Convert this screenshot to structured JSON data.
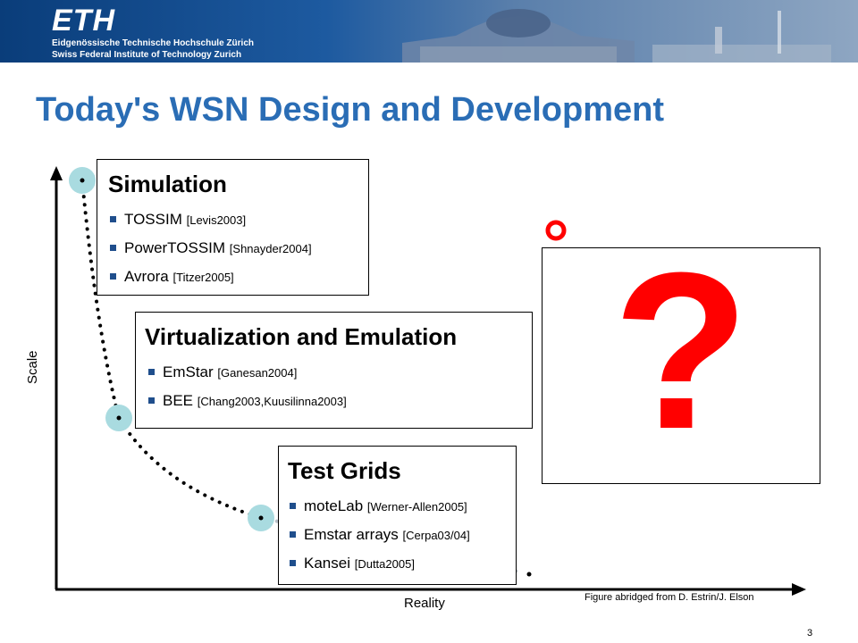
{
  "header": {
    "logo": "ETH",
    "institution_line1": "Eidgenössische Technische Hochschule Zürich",
    "institution_line2": "Swiss Federal Institute of Technology Zurich"
  },
  "title": "Today's WSN Design and Development",
  "boxes": {
    "simulation": {
      "heading": "Simulation",
      "items": [
        {
          "name": "TOSSIM",
          "ref": "[Levis2003]"
        },
        {
          "name": "PowerTOSSIM",
          "ref": "[Shnayder2004]"
        },
        {
          "name": "Avrora",
          "ref": "[Titzer2005]"
        }
      ]
    },
    "virtualization": {
      "heading": "Virtualization and Emulation",
      "items": [
        {
          "name": "EmStar",
          "ref": "[Ganesan2004]"
        },
        {
          "name": "BEE",
          "ref": "[Chang2003,Kuusilinna2003]"
        }
      ]
    },
    "testgrids": {
      "heading": "Test Grids",
      "items": [
        {
          "name": "moteLab",
          "ref": "[Werner-Allen2005]"
        },
        {
          "name": "Emstar arrays",
          "ref": "[Cerpa03/04]"
        },
        {
          "name": "Kansei",
          "ref": "[Dutta2005]"
        }
      ]
    },
    "unknown": {
      "symbol": "?"
    }
  },
  "axes": {
    "y_label": "Scale",
    "x_label": "Reality"
  },
  "caption": "Figure abridged from D. Estrin/J. Elson",
  "page_number": "3",
  "colors": {
    "title": "#2a6db5",
    "banner": "#0a3d7a",
    "question": "#ff0000",
    "marker": "#a9dbe0"
  }
}
